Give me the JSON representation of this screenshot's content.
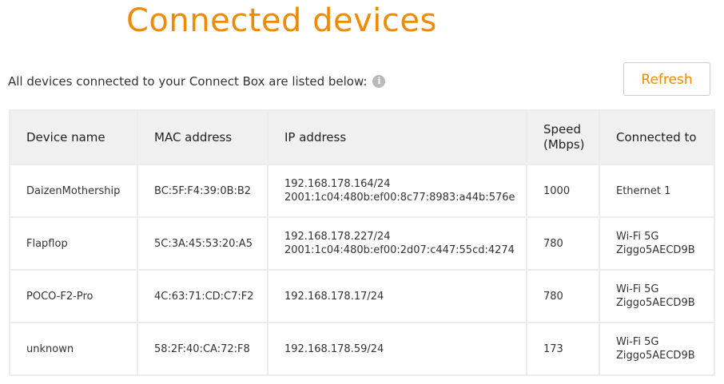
{
  "header": {
    "title": "Connected devices"
  },
  "intro": {
    "text": "All devices connected to your Connect Box are listed below:",
    "info_glyph": "i"
  },
  "toolbar": {
    "refresh_label": "Refresh"
  },
  "colors": {
    "accent": "#f08a00",
    "header_bg": "#f0f0f0",
    "border": "#ececec"
  },
  "table": {
    "columns": [
      "Device name",
      "MAC address",
      "IP address",
      "Speed (Mbps)",
      "Connected to"
    ],
    "rows": [
      {
        "name": "DaizenMothership",
        "mac": "BC:5F:F4:39:0B:B2",
        "ip": [
          "192.168.178.164/24",
          "2001:1c04:480b:ef00:8c77:8983:a44b:576e"
        ],
        "speed": "1000",
        "connected": [
          "Ethernet 1"
        ]
      },
      {
        "name": "Flapflop",
        "mac": "5C:3A:45:53:20:A5",
        "ip": [
          "192.168.178.227/24",
          "2001:1c04:480b:ef00:2d07:c447:55cd:4274"
        ],
        "speed": "780",
        "connected": [
          "Wi-Fi 5G",
          "Ziggo5AECD9B"
        ]
      },
      {
        "name": "POCO-F2-Pro",
        "mac": "4C:63:71:CD:C7:F2",
        "ip": [
          "192.168.178.17/24"
        ],
        "speed": "780",
        "connected": [
          "Wi-Fi 5G",
          "Ziggo5AECD9B"
        ]
      },
      {
        "name": "unknown",
        "mac": "58:2F:40:CA:72:F8",
        "ip": [
          "192.168.178.59/24"
        ],
        "speed": "173",
        "connected": [
          "Wi-Fi 5G",
          "Ziggo5AECD9B"
        ]
      }
    ]
  }
}
